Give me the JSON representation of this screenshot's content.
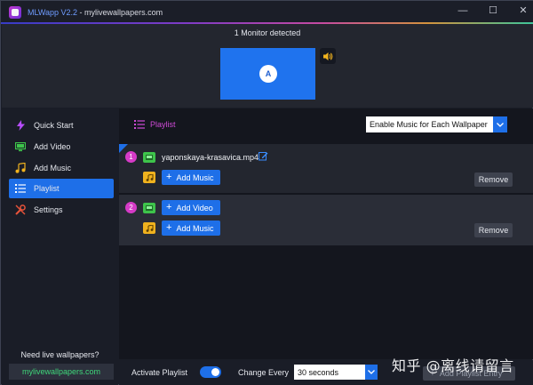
{
  "window": {
    "app_name": "MLWapp",
    "version": "V2.2",
    "separator": " - ",
    "site": "mylivewallpapers.com",
    "controls": {
      "minimize": "—",
      "maximize": "☐",
      "close": "✕"
    }
  },
  "monitor": {
    "detected_label": "1 Monitor detected",
    "badge": "A",
    "sound_icon": "speaker-icon"
  },
  "sidebar": {
    "items": [
      {
        "label": "Quick Start",
        "icon": "lightning-icon",
        "color": "#b84dff"
      },
      {
        "label": "Add Video",
        "icon": "monitor-icon",
        "color": "#3ec44b"
      },
      {
        "label": "Add Music",
        "icon": "music-note-icon",
        "color": "#f0b21e"
      },
      {
        "label": "Playlist",
        "icon": "list-icon",
        "color": "#ffffff",
        "active": true
      },
      {
        "label": "Settings",
        "icon": "tools-icon",
        "color": "#e8533a"
      }
    ],
    "promo_text": "Need live wallpapers?",
    "promo_link": "mylivewallpapers.com"
  },
  "main": {
    "section_title": "Playlist",
    "music_mode": "Enable Music for Each Wallpaper",
    "entries": [
      {
        "number": "1",
        "file": "yaponskaya-krasavica.mp4",
        "music_button": "Add Music",
        "remove": "Remove"
      },
      {
        "number": "2",
        "video_button": "Add Video",
        "music_button": "Add Music",
        "remove": "Remove"
      }
    ]
  },
  "bottom": {
    "activate_label": "Activate Playlist",
    "activate_on": true,
    "change_label": "Change Every",
    "interval": "30 seconds",
    "add_entry": "Add Playlist Entry"
  },
  "watermark": "知乎 @离线请留言",
  "colors": {
    "accent": "#1e6fe8",
    "magenta": "#d63bc7",
    "green": "#3ec44b",
    "gold": "#f0b21e",
    "link_green": "#3fd87a"
  }
}
